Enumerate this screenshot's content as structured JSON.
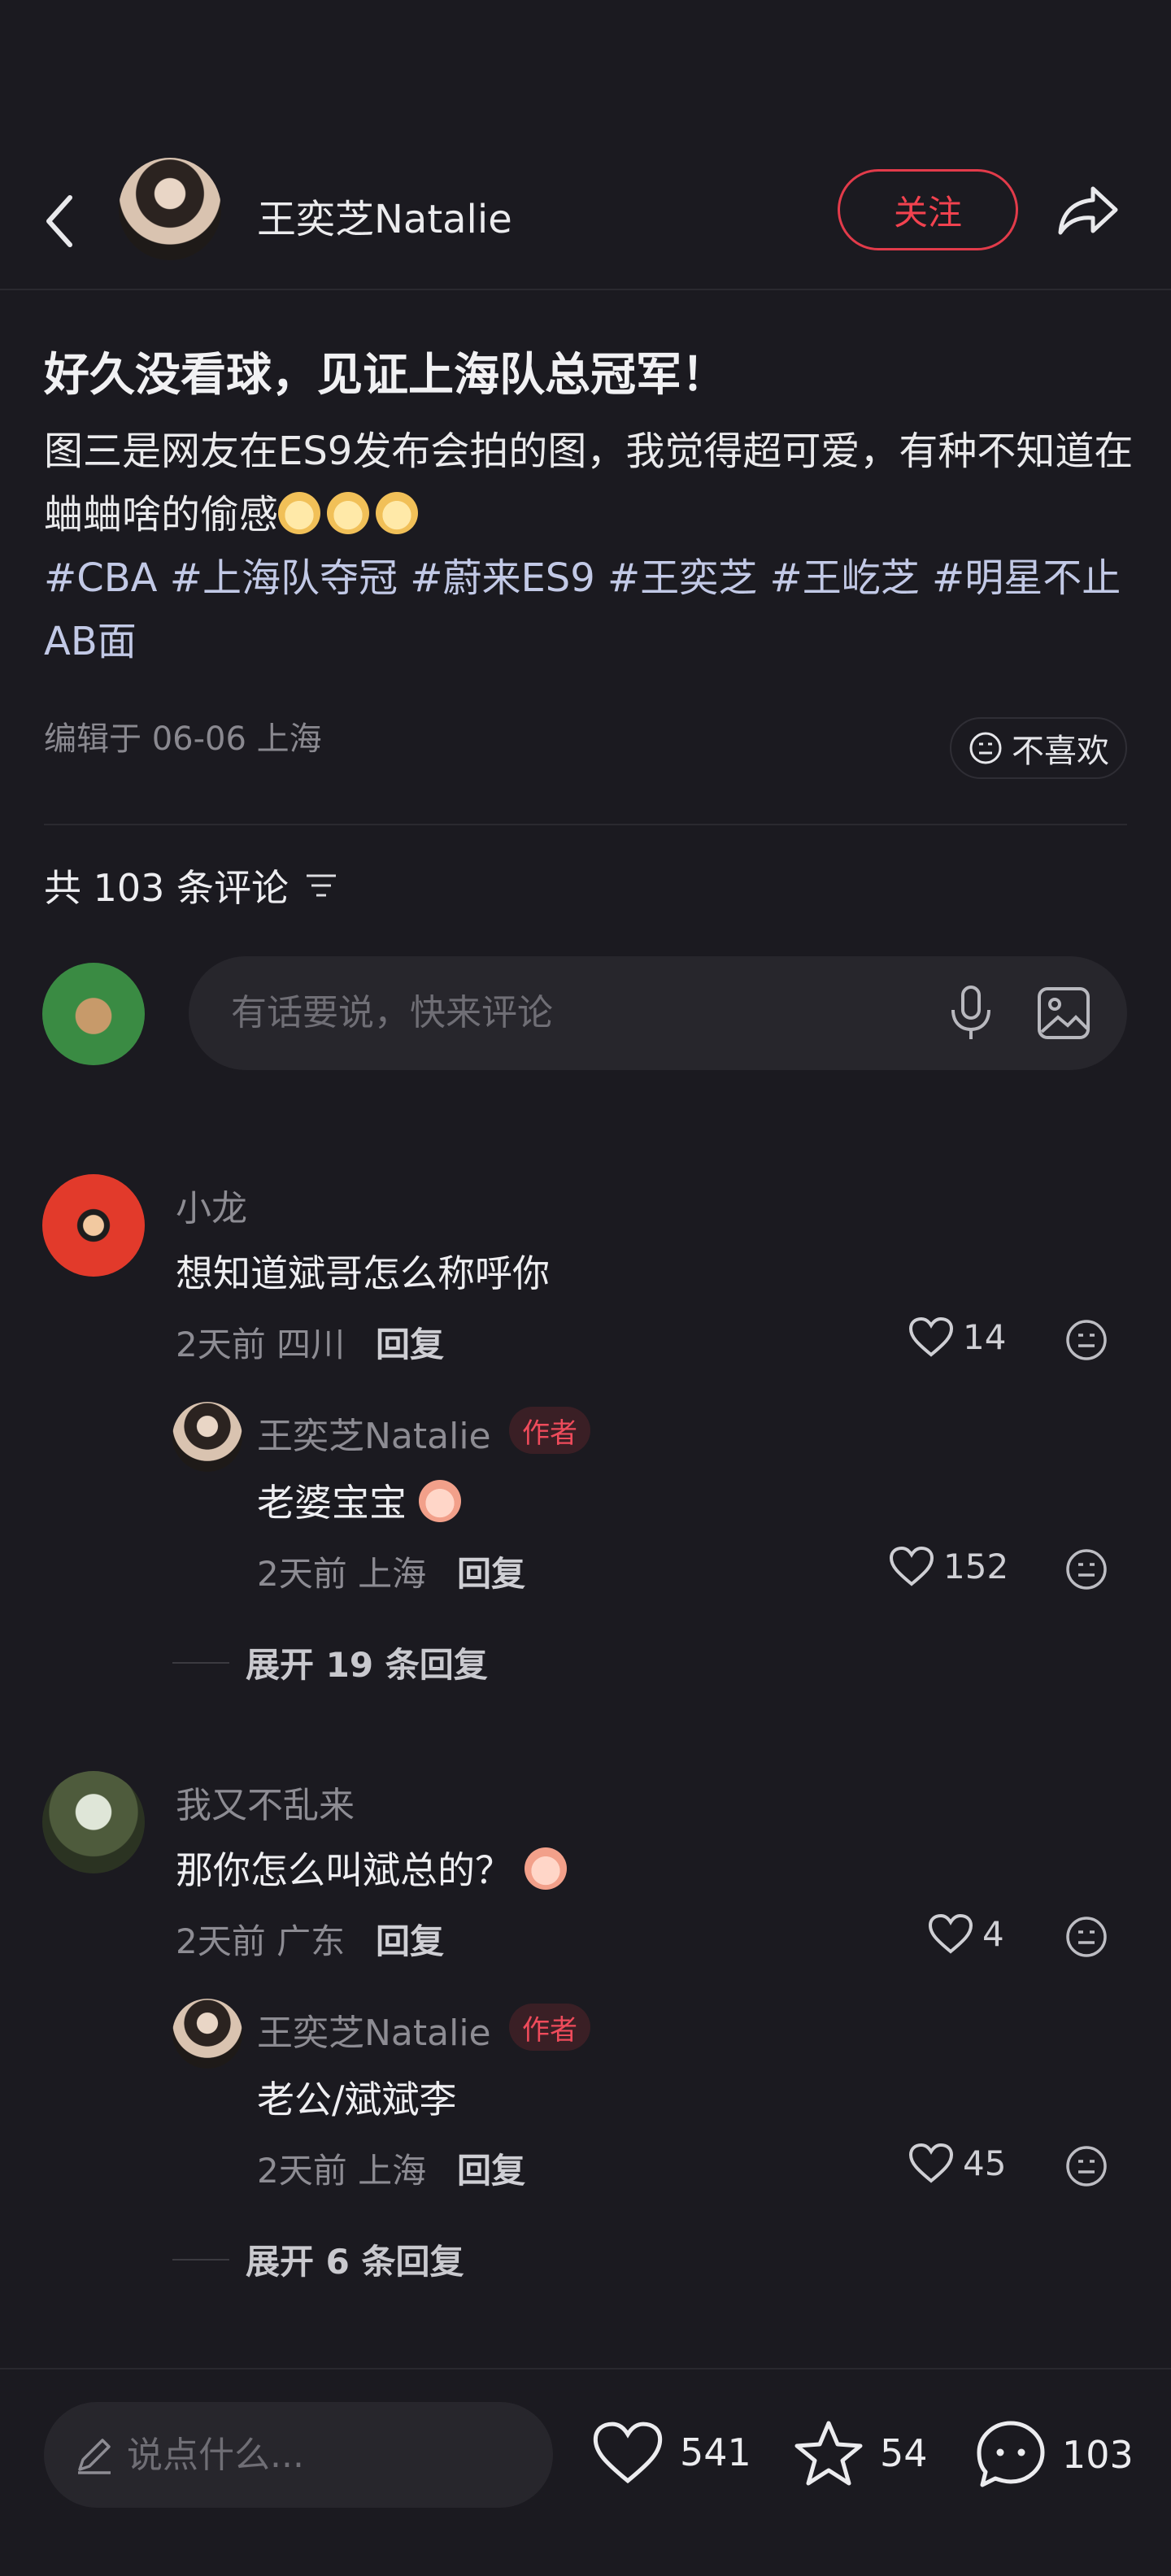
{
  "header": {
    "author_name": "王奕芝Natalie",
    "follow_label": "关注"
  },
  "post": {
    "title": "好久没看球，见证上海队总冠军！",
    "body": "图三是网友在ES9发布会拍的图，我觉得超可爱，有种不知道在蛐蛐啥的偷感",
    "tags": "#CBA #上海队夺冠 #蔚来ES9 #王奕芝 #王屹芝 #明星不止AB面",
    "edit_meta": "编辑于 06-06 上海",
    "dislike_label": "不喜欢"
  },
  "comments_header": {
    "count_label": "共 103 条评论",
    "input_placeholder": "有话要说，快来评论"
  },
  "comments": [
    {
      "name": "小龙",
      "text": "想知道斌哥怎么称呼你",
      "meta": "2天前 四川",
      "reply_label": "回复",
      "likes": "14",
      "reply": {
        "name": "王奕芝Natalie",
        "badge": "作者",
        "text": "老婆宝宝",
        "meta": "2天前 上海",
        "reply_label": "回复",
        "likes": "152"
      },
      "expand_label": "展开 19 条回复"
    },
    {
      "name": "我又不乱来",
      "text": "那你怎么叫斌总的？",
      "meta": "2天前 广东",
      "reply_label": "回复",
      "likes": "4",
      "reply": {
        "name": "王奕芝Natalie",
        "badge": "作者",
        "text": "老公/斌斌李",
        "meta": "2天前 上海",
        "reply_label": "回复",
        "likes": "45"
      },
      "expand_label": "展开 6 条回复"
    }
  ],
  "bottom_bar": {
    "input_placeholder": "说点什么...",
    "likes": "541",
    "favorites": "54",
    "comments": "103"
  },
  "colors": {
    "background": "#1b1a20",
    "accent_red": "#f2424f",
    "tag_blue": "#c2c9e6"
  },
  "icons": [
    "back-icon",
    "share-icon",
    "dislike-face-icon",
    "filter-icon",
    "mic-icon",
    "image-icon",
    "heart-icon",
    "reaction-face-icon",
    "pencil-icon",
    "star-icon",
    "comment-bubble-icon"
  ]
}
